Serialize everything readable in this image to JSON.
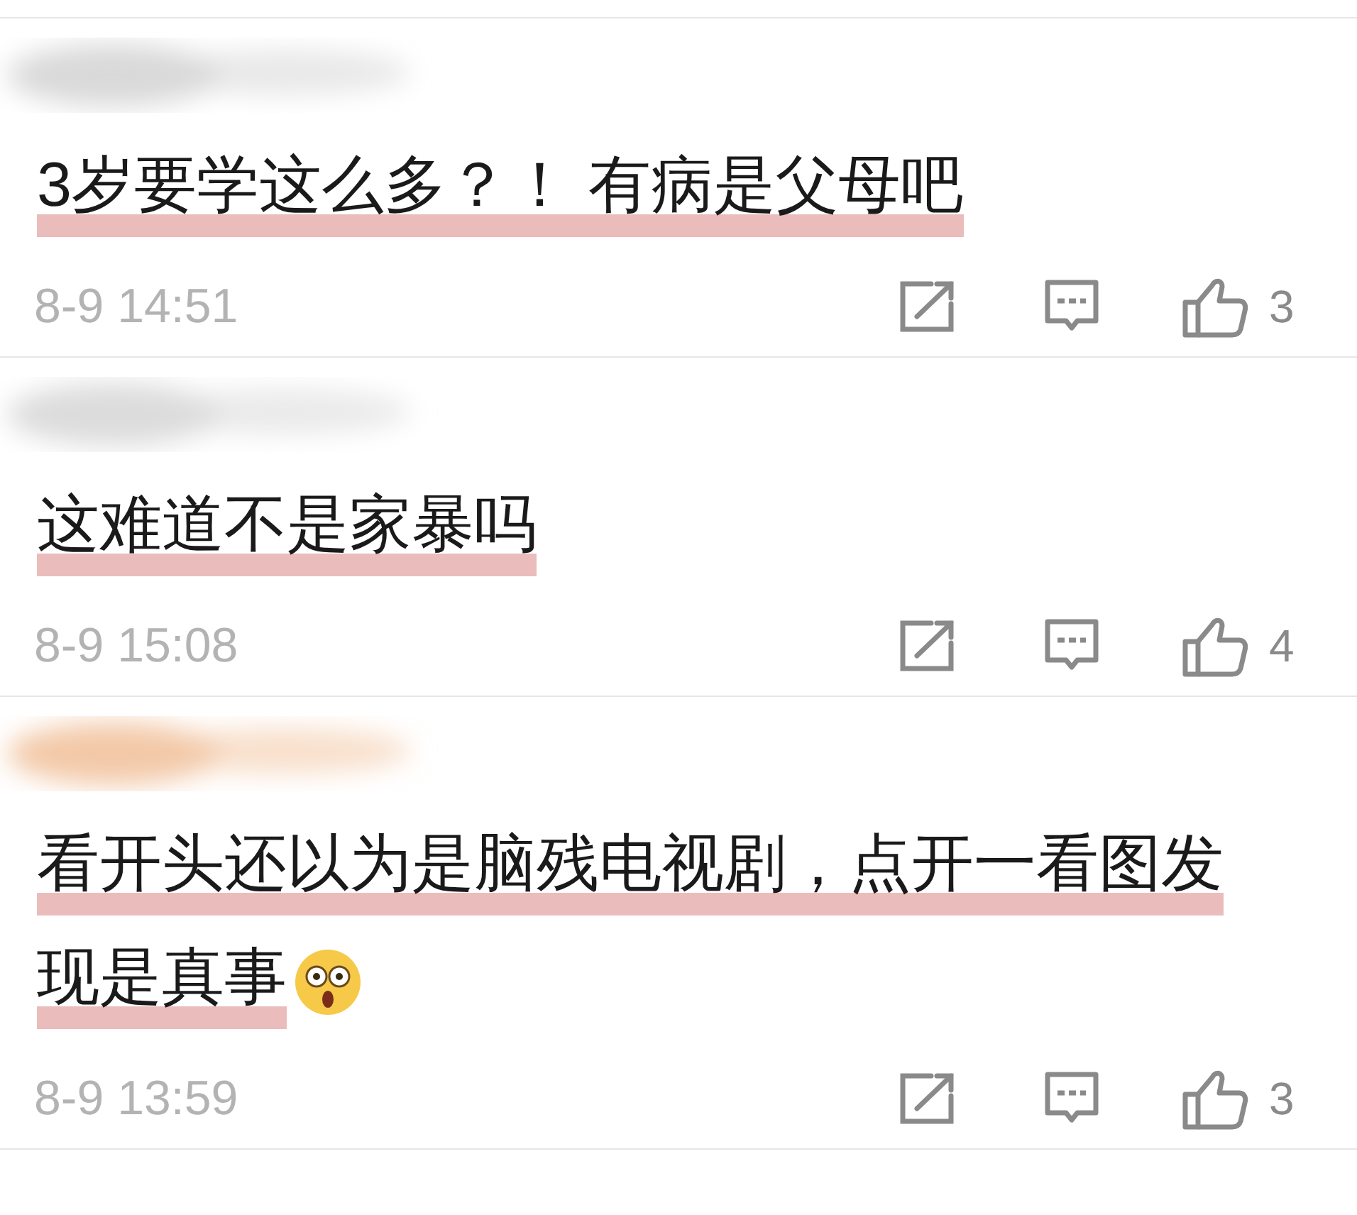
{
  "comments": [
    {
      "lines": [
        "3岁要学这么多？！ 有病是父母吧"
      ],
      "emoji": false,
      "time": "8-9 14:51",
      "likes": "3"
    },
    {
      "lines": [
        "这难道不是家暴吗"
      ],
      "emoji": false,
      "time": "8-9 15:08",
      "likes": "4"
    },
    {
      "lines": [
        "看开头还以为是脑残电视剧，点开一看图发",
        "现是真事"
      ],
      "emoji": true,
      "time": "8-9 13:59",
      "likes": "3"
    }
  ]
}
